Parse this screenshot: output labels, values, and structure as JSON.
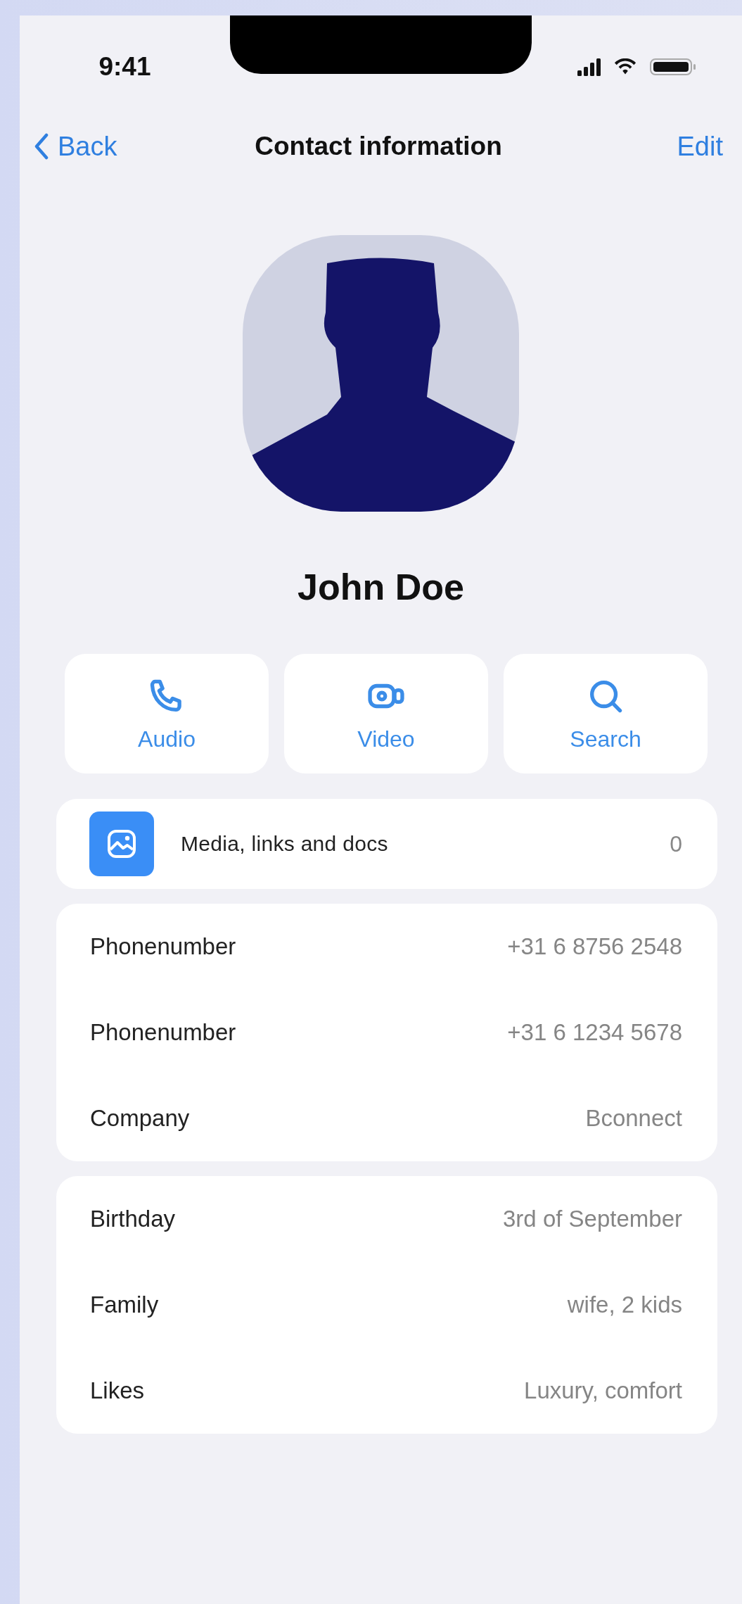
{
  "status_bar": {
    "time": "9:41"
  },
  "nav": {
    "back": "Back",
    "title": "Contact information",
    "action": "Edit"
  },
  "contact": {
    "name": "John Doe"
  },
  "actions": [
    {
      "kind": "audio",
      "label": "Audio"
    },
    {
      "kind": "video",
      "label": "Video"
    },
    {
      "kind": "search",
      "label": "Search"
    }
  ],
  "media": {
    "label": "Media, links and docs",
    "count": "0"
  },
  "sections": [
    {
      "rows": [
        {
          "label": "Phonenumber",
          "value": "+31 6 8756 2548"
        },
        {
          "label": "Phonenumber",
          "value": "+31 6 1234 5678"
        },
        {
          "label": "Company",
          "value": "Bconnect"
        }
      ]
    },
    {
      "rows": [
        {
          "label": "Birthday",
          "value": "3rd of September"
        },
        {
          "label": "Family",
          "value": "wife, 2 kids"
        },
        {
          "label": "Likes",
          "value": "Luxury, comfort"
        }
      ]
    }
  ]
}
